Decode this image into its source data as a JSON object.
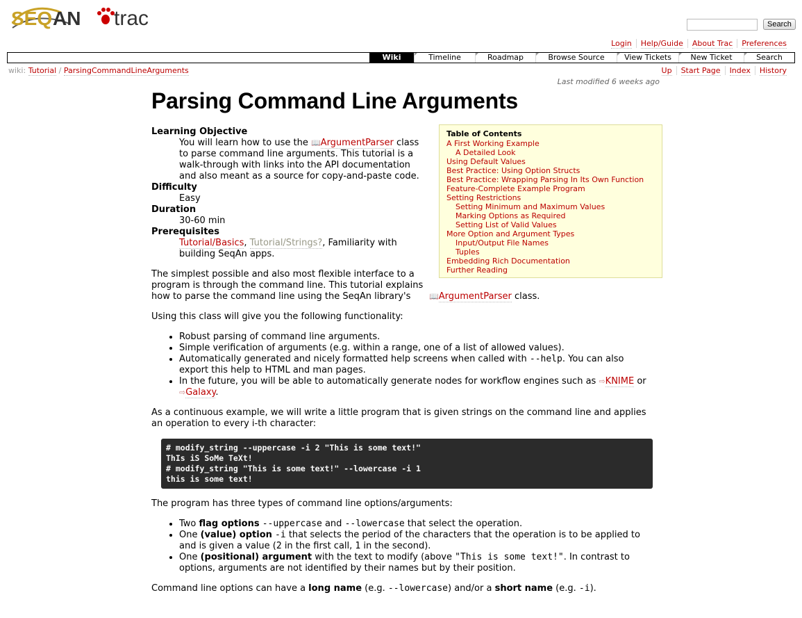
{
  "logo": {
    "seq": "SEQ",
    "an": "AN",
    "trac": "trac"
  },
  "search": {
    "placeholder": "",
    "button": "Search"
  },
  "metanav": [
    "Login",
    "Help/Guide",
    "About Trac",
    "Preferences"
  ],
  "mainnav": [
    "Wiki",
    "Timeline",
    "Roadmap",
    "Browse Source",
    "View Tickets",
    "New Ticket",
    "Search"
  ],
  "breadcrumb": {
    "prefix": "wiki:",
    "tutorial": "Tutorial",
    "sep": "/",
    "page": "ParsingCommandLineArguments"
  },
  "ctxtnav": [
    "Up",
    "Start Page",
    "Index",
    "History"
  ],
  "last_modified": {
    "label": "Last modified",
    "age": "6 weeks ago"
  },
  "title": "Parsing Command Line Arguments",
  "toc": {
    "title": "Table of Contents",
    "items": [
      {
        "label": "A First Working Example",
        "level": 1
      },
      {
        "label": "A Detailed Look",
        "level": 2
      },
      {
        "label": "Using Default Values",
        "level": 1
      },
      {
        "label": "Best Practice: Using Option Structs",
        "level": 1
      },
      {
        "label": "Best Practice: Wrapping Parsing In Its Own Function",
        "level": 1
      },
      {
        "label": "Feature-Complete Example Program",
        "level": 1
      },
      {
        "label": "Setting Restrictions",
        "level": 1
      },
      {
        "label": "Setting Minimum and Maximum Values",
        "level": 2
      },
      {
        "label": "Marking Options as Required",
        "level": 2
      },
      {
        "label": "Setting List of Valid Values",
        "level": 2
      },
      {
        "label": "More Option and Argument Types",
        "level": 1
      },
      {
        "label": "Input/Output File Names",
        "level": 2
      },
      {
        "label": "Tuples",
        "level": 2
      },
      {
        "label": "Embedding Rich Documentation",
        "level": 1
      },
      {
        "label": "Further Reading",
        "level": 1
      }
    ]
  },
  "meta": {
    "objective_term": "Learning Objective",
    "objective_pre": "You will learn how to use the ",
    "objective_link": "ArgumentParser",
    "objective_post": " class to parse command line arguments. This tutorial is a walk-through with links into the API documentation and also meant as a source for copy-and-paste code.",
    "difficulty_term": "Difficulty",
    "difficulty": "Easy",
    "duration_term": "Duration",
    "duration": "30-60 min",
    "prereq_term": "Prerequisites",
    "prereq_link1": "Tutorial/Basics",
    "prereq_sep": ", ",
    "prereq_link2": "Tutorial/Strings?",
    "prereq_post": ", Familiarity with building SeqAn apps."
  },
  "intro": {
    "pre": "The simplest possible and also most flexible interface to a program is through the command line. This tutorial explains how to parse the command line using the SeqAn library's ",
    "link": "ArgumentParser",
    "post": " class."
  },
  "functionality_intro": "Using this class will give you the following functionality:",
  "features": {
    "f1": "Robust parsing of command line arguments.",
    "f2": "Simple verification of arguments (e.g. within a range, one of a list of allowed values).",
    "f3_pre": "Automatically generated and nicely formatted help screens when called with ",
    "f3_code": "--help",
    "f3_post": ". You can also export this help to HTML and man pages.",
    "f4_pre": "In the future, you will be able to automatically generate nodes for workflow engines such as ",
    "f4_link1": "KNIME",
    "f4_mid": " or ",
    "f4_link2": "Galaxy",
    "f4_post": "."
  },
  "example_intro": "As a continuous example, we will write a little program that is given strings on the command line and applies an operation to every i-th character:",
  "code_lines": [
    "# modify_string --uppercase -i 2 \"This is some text!\"",
    "ThIs iS SoMe TeXt!",
    "# modify_string \"This is some text!\" --lowercase -i 1",
    "this is some text!"
  ],
  "types_intro": "The program has three types of command line options/arguments:",
  "types": {
    "t1_pre": "Two ",
    "t1_bold": "flag options",
    "t1_code1": "--uppercase",
    "t1_and": " and ",
    "t1_code2": "--lowercase",
    "t1_post": " that select the operation.",
    "t2_pre": "One ",
    "t2_bold": "(value) option",
    "t2_code": "-i",
    "t2_mid": " that selects the period of the characters that the operation is to be applied to and is given a value (",
    "t2_code2": "2",
    "t2_mid2": " in the first call, ",
    "t2_code3": "1",
    "t2_post": " in the second).",
    "t3_pre": "One ",
    "t3_bold": "(positional) argument",
    "t3_mid": " with the text to modify (above ",
    "t3_code": "\"This is some text!\"",
    "t3_post": ". In contrast to options, arguments are not identified by their names but by their position."
  },
  "names": {
    "pre": "Command line options can have a ",
    "bold1": "long name",
    "mid1": " (e.g. ",
    "code1": "--lowercase",
    "mid2": ") and/or a ",
    "bold2": "short name",
    "mid3": " (e.g. ",
    "code2": "-i",
    "post": ")."
  }
}
